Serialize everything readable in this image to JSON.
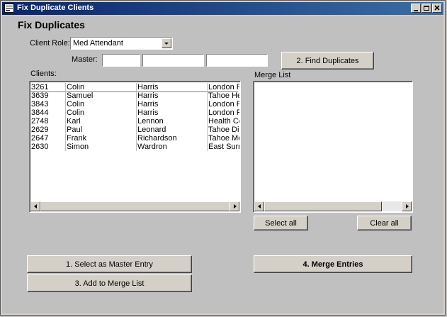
{
  "window": {
    "title": "Fix Duplicate Clients"
  },
  "heading": "Fix Duplicates",
  "client_role": {
    "label": "Client Role:",
    "value": "Med Attendant"
  },
  "master": {
    "label": "Master:",
    "fields": [
      "",
      "",
      ""
    ]
  },
  "buttons": {
    "find_duplicates": "2. Find Duplicates",
    "select_all": "Select all",
    "clear_all": "Clear all",
    "select_master": "1. Select as Master Entry",
    "add_merge": "3. Add to Merge List",
    "merge_entries": "4. Merge Entries"
  },
  "clients": {
    "label": "Clients:",
    "rows": [
      {
        "id": "3261",
        "first": "Colin",
        "last": "Harris",
        "org": "London Ro"
      },
      {
        "id": "3639",
        "first": "Samuel",
        "last": "Harris",
        "org": "Tahoe Hea"
      },
      {
        "id": "3843",
        "first": "Colin",
        "last": "Harris",
        "org": "London Ro"
      },
      {
        "id": "3844",
        "first": "Colin",
        "last": "Harris",
        "org": "London Ro"
      },
      {
        "id": "2748",
        "first": "Karl",
        "last": "Lennon",
        "org": "Health Cer"
      },
      {
        "id": "2629",
        "first": "Paul",
        "last": "Leonard",
        "org": "Tahoe Dist"
      },
      {
        "id": "2647",
        "first": "Frank",
        "last": "Richardson",
        "org": "Tahoe Mec"
      },
      {
        "id": "2630",
        "first": "Simon",
        "last": "Wardron",
        "org": "East Surre"
      }
    ]
  },
  "merge_list": {
    "label": "Merge List"
  }
}
